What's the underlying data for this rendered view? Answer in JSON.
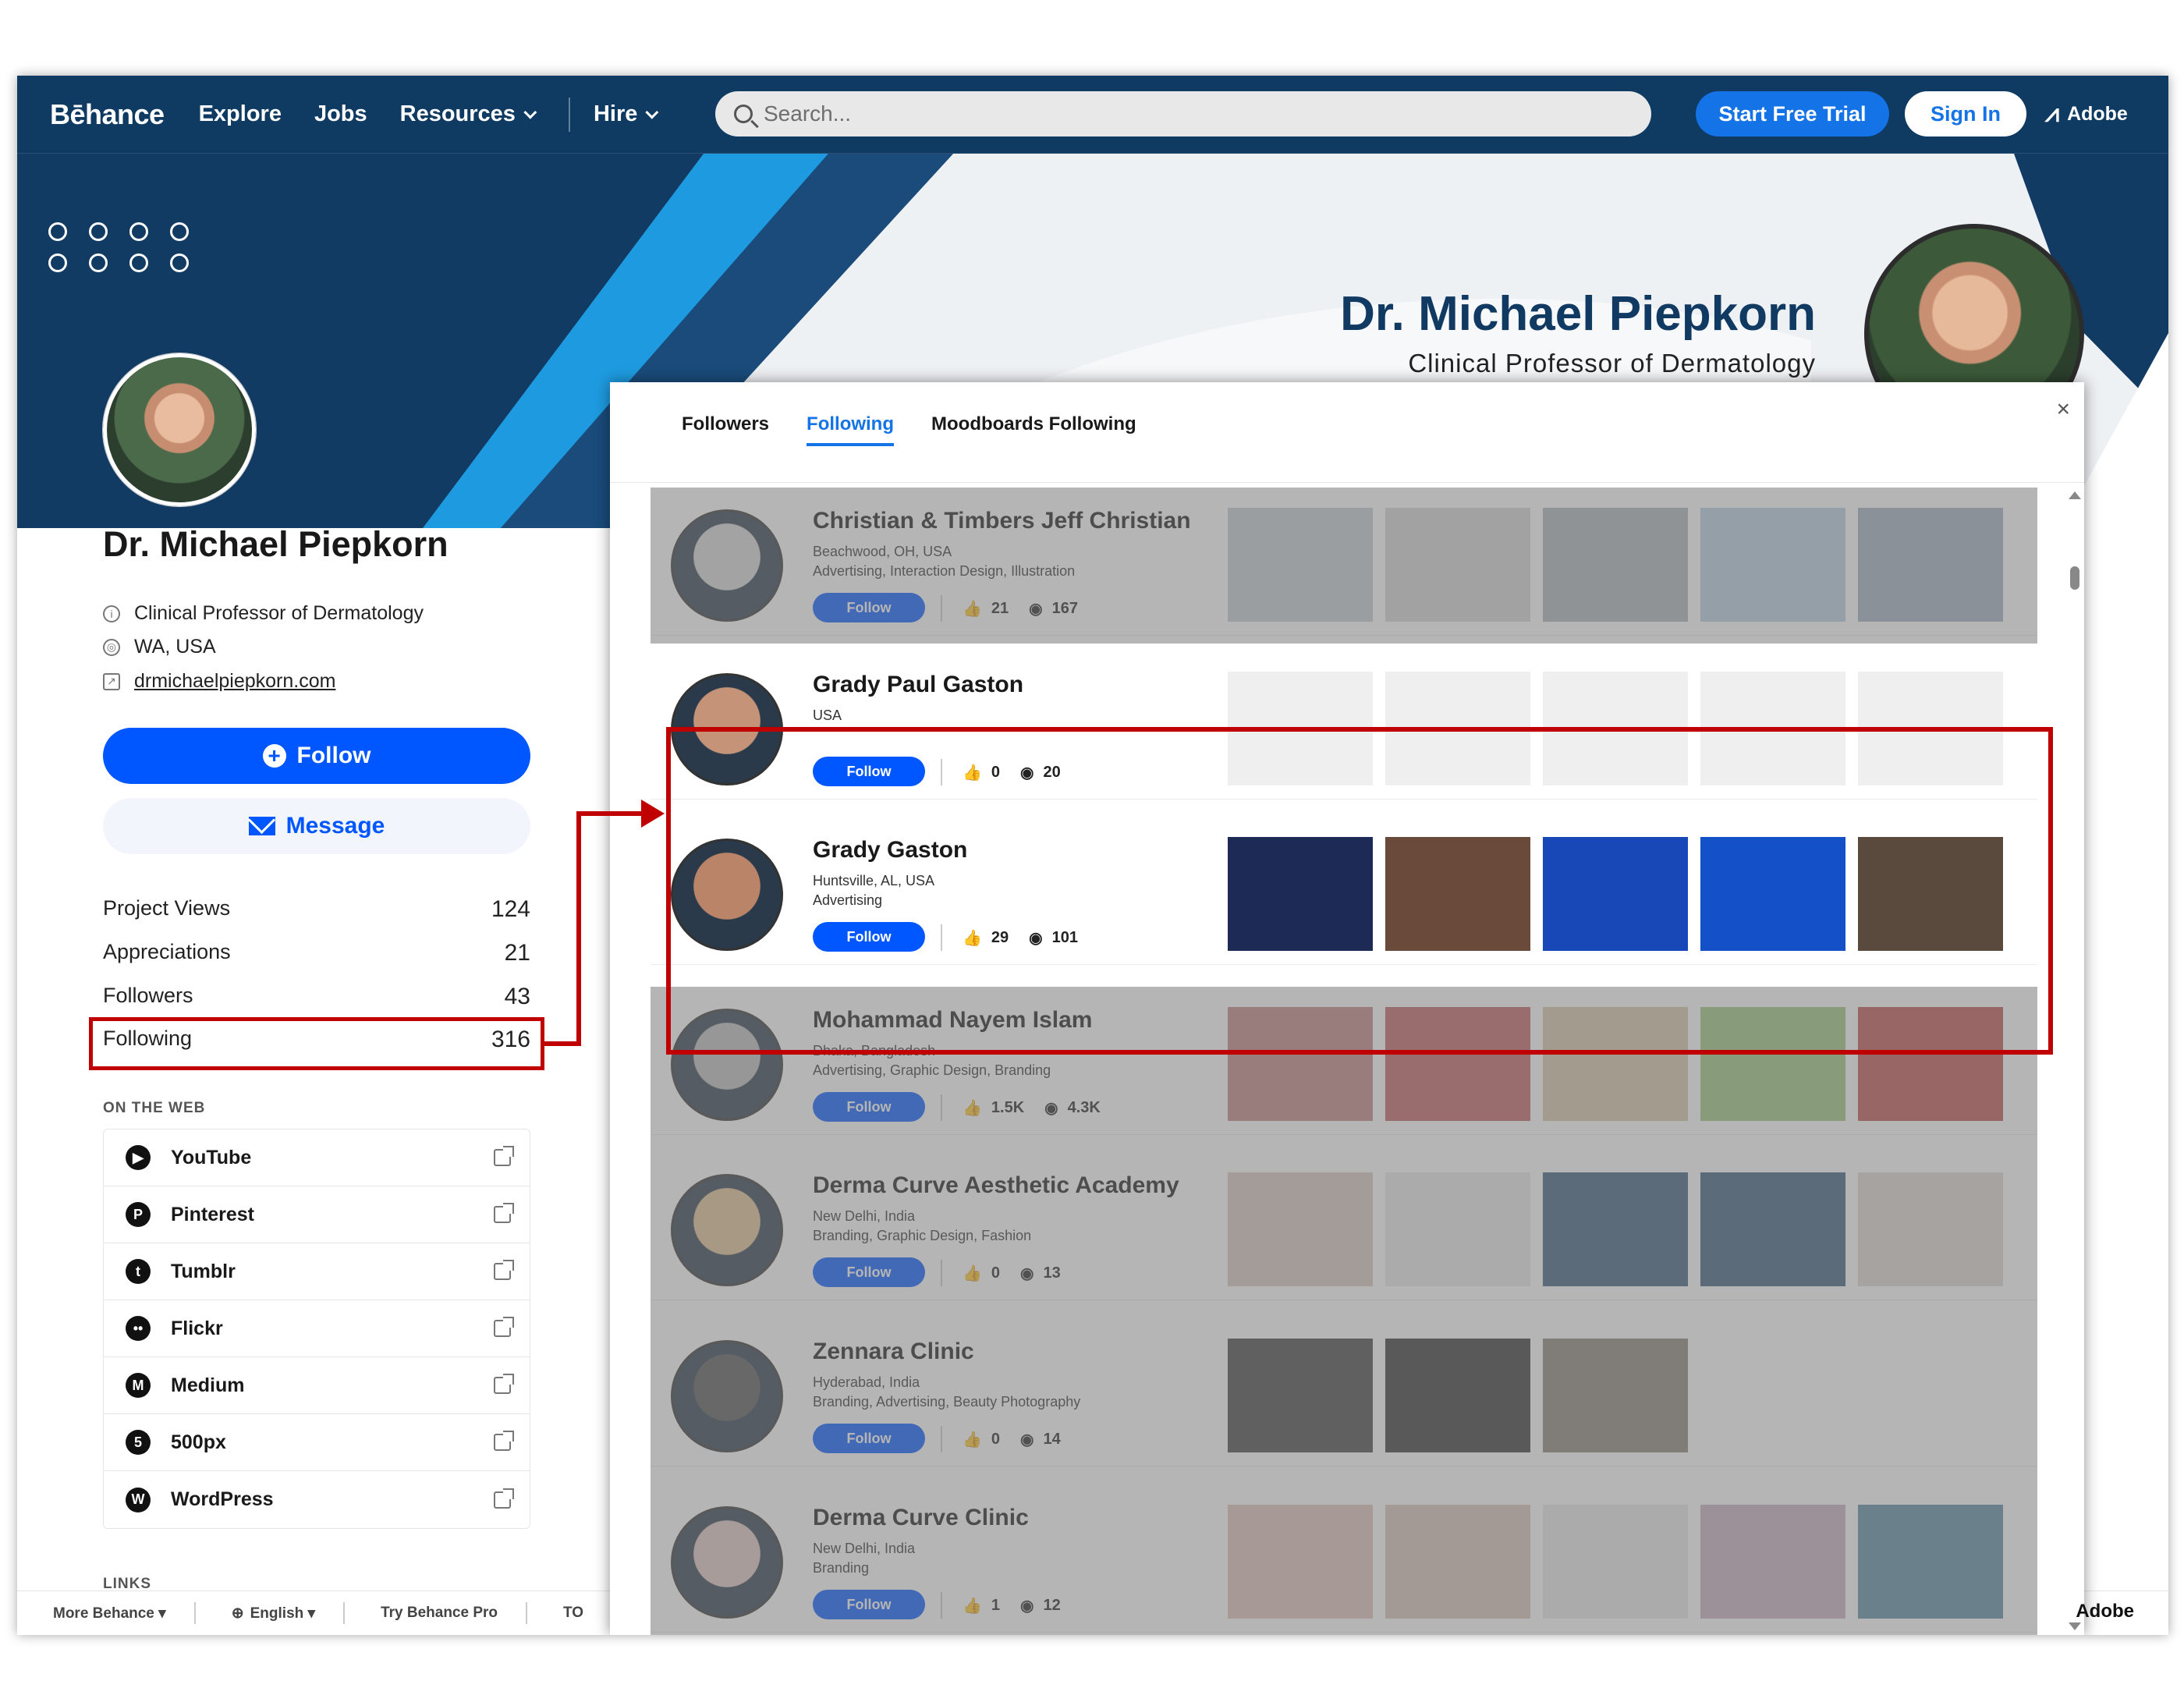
{
  "nav": {
    "logo": "Bēhance",
    "items": [
      "Explore",
      "Jobs",
      "Resources",
      "Hire"
    ],
    "search_placeholder": "Search...",
    "trial_label": "Start Free Trial",
    "signin_label": "Sign In",
    "adobe_label": "Adobe"
  },
  "banner": {
    "name": "Dr. Michael Piepkorn",
    "title": "Clinical Professor of Dermatology"
  },
  "profile": {
    "name": "Dr. Michael Piepkorn",
    "occupation": "Clinical Professor of Dermatology",
    "location": "WA, USA",
    "website": "drmichaelpiepkorn.com",
    "follow_label": "Follow",
    "message_label": "Message",
    "stats": [
      {
        "label": "Project Views",
        "value": "124"
      },
      {
        "label": "Appreciations",
        "value": "21"
      },
      {
        "label": "Followers",
        "value": "43"
      },
      {
        "label": "Following",
        "value": "316"
      }
    ],
    "on_the_web_heading": "ON THE WEB",
    "links_heading": "LINKS",
    "web_links": [
      {
        "label": "YouTube",
        "glyph": "▶"
      },
      {
        "label": "Pinterest",
        "glyph": "P"
      },
      {
        "label": "Tumblr",
        "glyph": "t"
      },
      {
        "label": "Flickr",
        "glyph": "••"
      },
      {
        "label": "Medium",
        "glyph": "M"
      },
      {
        "label": "500px",
        "glyph": "5"
      },
      {
        "label": "WordPress",
        "glyph": "W"
      }
    ]
  },
  "footer": {
    "items": [
      "More Behance ▾",
      "English ▾",
      "Try Behance Pro",
      "TO"
    ],
    "adobe": "Adobe"
  },
  "modal": {
    "tabs": [
      "Followers",
      "Following",
      "Moodboards Following"
    ],
    "active_tab": "Following",
    "close": "×",
    "follow_label": "Follow",
    "people": [
      {
        "name": "Christian & Timbers Jeff Christian",
        "location": "Beachwood, OH, USA",
        "fields": "Advertising, Interaction Design, Illustration",
        "appreciations": "21",
        "views": "167",
        "dimmed": true,
        "avatar_color": "#d8d8d8",
        "thumb_colors": [
          "#c5ccd3",
          "#d6d6d6",
          "#aeb4ba",
          "#b9cfe0",
          "#9fb0c0"
        ]
      },
      {
        "name": "Grady Paul Gaston",
        "location": "USA",
        "fields": "",
        "appreciations": "0",
        "views": "20",
        "dimmed": false,
        "avatar_color": "#c49378",
        "thumb_colors": [
          "#efefef",
          "#efefef",
          "#efefef",
          "#efefef",
          "#efefef"
        ]
      },
      {
        "name": "Grady Gaston",
        "location": "Huntsville, AL, USA",
        "fields": "Advertising",
        "appreciations": "29",
        "views": "101",
        "dimmed": false,
        "avatar_color": "#b98468",
        "thumb_colors": [
          "#1d2a55",
          "#6a4a3a",
          "#1848b8",
          "#1450c8",
          "#5a4a3e"
        ]
      },
      {
        "name": "Mohammad Nayem Islam",
        "location": "Dhaka, Bangladesh",
        "fields": "Advertising, Graphic Design, Branding",
        "appreciations": "1.5K",
        "views": "4.3K",
        "dimmed": true,
        "avatar_color": "#bdbdbd",
        "thumb_colors": [
          "#c08080",
          "#c06060",
          "#d8c8a8",
          "#9cc880",
          "#c05050"
        ]
      },
      {
        "name": "Derma Curve Aesthetic Academy",
        "location": "New Delhi, India",
        "fields": "Branding, Graphic Design, Fashion",
        "appreciations": "0",
        "views": "13",
        "dimmed": true,
        "avatar_color": "#e0c090",
        "thumb_colors": [
          "#d8c8c0",
          "#e8e8e8",
          "#3a5c7a",
          "#3a5c7a",
          "#e0d8d0"
        ]
      },
      {
        "name": "Zennara Clinic",
        "location": "Hyderabad, India",
        "fields": "Branding, Advertising, Beauty Photography",
        "appreciations": "0",
        "views": "14",
        "dimmed": true,
        "avatar_color": "#555555",
        "thumb_colors": [
          "#444444",
          "#333333",
          "#8a8478",
          "#ffffff",
          "#ffffff"
        ]
      },
      {
        "name": "Derma Curve Clinic",
        "location": "New Delhi, India",
        "fields": "Branding",
        "appreciations": "1",
        "views": "12",
        "dimmed": true,
        "avatar_color": "#e0c8c0",
        "thumb_colors": [
          "#e0c0b8",
          "#d8c0b8",
          "#e8e8e8",
          "#c8b0c0",
          "#5a8aa0"
        ]
      }
    ]
  }
}
